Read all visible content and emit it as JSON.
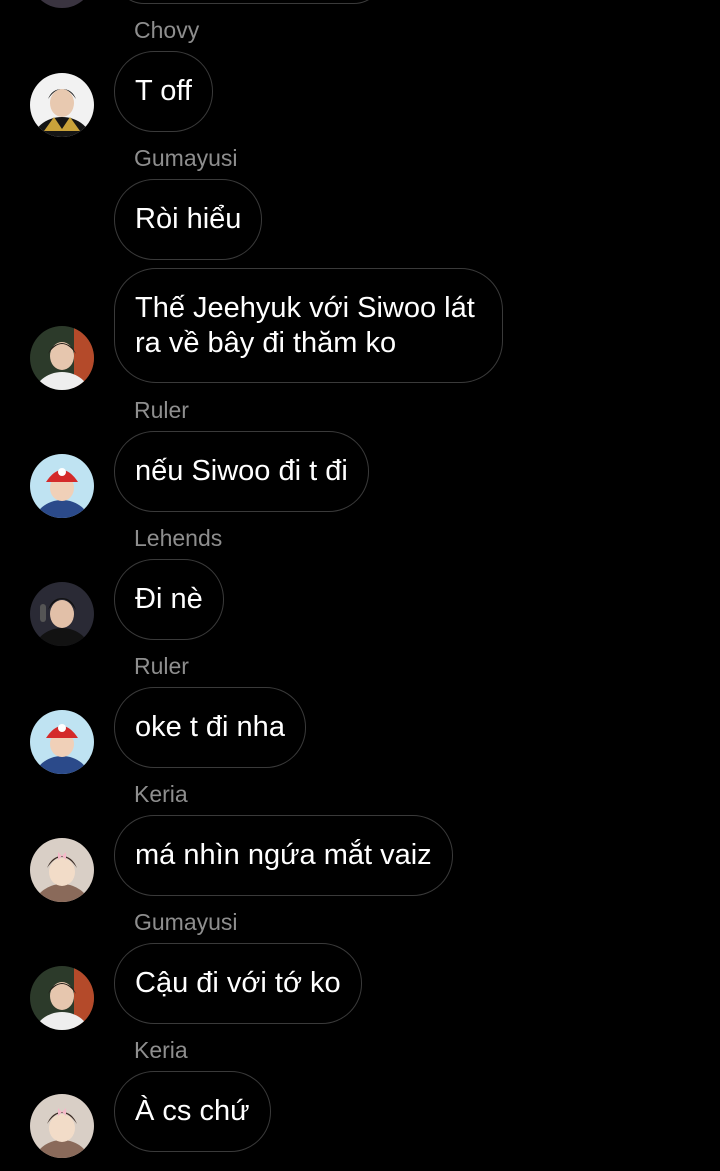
{
  "messages": [
    {
      "sender": "Chovy",
      "text": "T off",
      "avatar": "chovy-avatar"
    },
    {
      "sender": "Gumayusi",
      "text": "Ròi hiểu",
      "avatar": ""
    },
    {
      "sender": "",
      "text": "Thế Jeehyuk với Siwoo lát ra về bây đi thăm ko",
      "avatar": "gumayusi-avatar"
    },
    {
      "sender": "Ruler",
      "text": "nếu Siwoo đi t đi",
      "avatar": "ruler-avatar"
    },
    {
      "sender": "Lehends",
      "text": "Đi nè",
      "avatar": "lehends-avatar"
    },
    {
      "sender": "Ruler",
      "text": "oke t đi nha",
      "avatar": "ruler-avatar"
    },
    {
      "sender": "Keria",
      "text": "má nhìn ngứa mắt vaiz",
      "avatar": "keria-avatar"
    },
    {
      "sender": "Gumayusi",
      "text": "Cậu đi với tớ ko",
      "avatar": "gumayusi-avatar"
    },
    {
      "sender": "Keria",
      "text": "À cs chứ",
      "avatar": "keria-avatar"
    }
  ],
  "colors": {
    "background": "#000000",
    "bubble_border": "#3a3a3a",
    "sender_name": "#8e8e8e",
    "text": "#ffffff"
  }
}
